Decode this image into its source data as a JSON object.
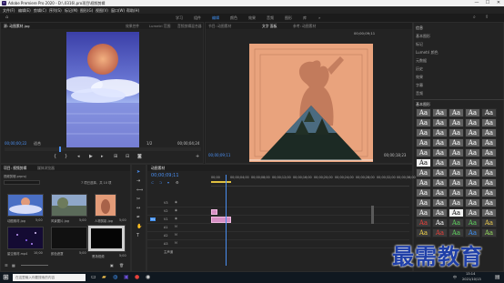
{
  "window": {
    "title": "Adobe Premiere Pro 2020 - D:\\.0316\\.pro项目\\视频剪辑",
    "controls": [
      "—",
      "☐",
      "✕"
    ]
  },
  "menu": [
    "文件(F)",
    "编辑(E)",
    "剪辑(C)",
    "序列(S)",
    "标记(M)",
    "图形(G)",
    "视图(V)",
    "窗口(W)",
    "帮助(H)"
  ],
  "workspaces": [
    "学习",
    "组件",
    "编辑",
    "颜色",
    "效果",
    "音频",
    "图形",
    "库",
    "»"
  ],
  "active_workspace": "编辑",
  "source_panel": {
    "tabs": [
      "源: 动图素材.jpg",
      "效果控件",
      "Lumetri 范围",
      "音频剪辑混合器"
    ],
    "timecode_in": "00;00;00;22",
    "fit_label": "适合",
    "ratio_label": "1/2",
    "timecode_out": "00;00;04;24"
  },
  "program_panel": {
    "tabs": [
      "节目: 动图素材",
      "文字 面板",
      "参考: 动图素材"
    ],
    "timecode": "00;00;09;11",
    "fit_label": "适合",
    "ratio_label": "完整",
    "duration": "00;00;18;23"
  },
  "project_panel": {
    "tabs": [
      "项目: 视频剪辑",
      "媒体浏览器"
    ],
    "project_file": "视频剪辑.prproj",
    "item_count": "7 项已选择，共 10 项",
    "items": [
      {
        "name": "动图素材.jpg",
        "duration": "5;00"
      },
      {
        "name": "风景图片.jpg",
        "duration": "5;00"
      },
      {
        "name": "人物剪影.jpg",
        "duration": "5;00"
      },
      {
        "name": "星空素材.mp4",
        "duration": "10;00"
      },
      {
        "name": "颜色遮罩",
        "duration": "5;00"
      },
      {
        "name": "黑场视频",
        "duration": "5;00"
      }
    ]
  },
  "timeline": {
    "tab": "动图素材",
    "timecode": "00;00;09;11",
    "ruler": [
      "00;00",
      "00;00;04;00",
      "00;00;08;00",
      "00;00;12;00",
      "00;00;16;00",
      "00;00;20;00",
      "00;00;24;00",
      "00;00;28;00",
      "00;00;32;00",
      "00;00;36;00"
    ],
    "tracks": [
      "V3",
      "V2",
      "V1",
      "A1",
      "A2",
      "A3"
    ],
    "master_label": "主声道"
  },
  "right_panel": {
    "items": [
      "信息",
      "基本图形",
      "标记",
      "Lumetri 颜色",
      "元数据",
      "历史",
      "效果",
      "字幕",
      "音频",
      "Essential Graphics"
    ],
    "section_title": "基本图形",
    "glyph": "Aa"
  },
  "watermark": "最需教育",
  "taskbar": {
    "search_placeholder": "在这里输入你要搜索的内容",
    "time": "13:14",
    "date": "2021/10/13",
    "lang": "中"
  }
}
